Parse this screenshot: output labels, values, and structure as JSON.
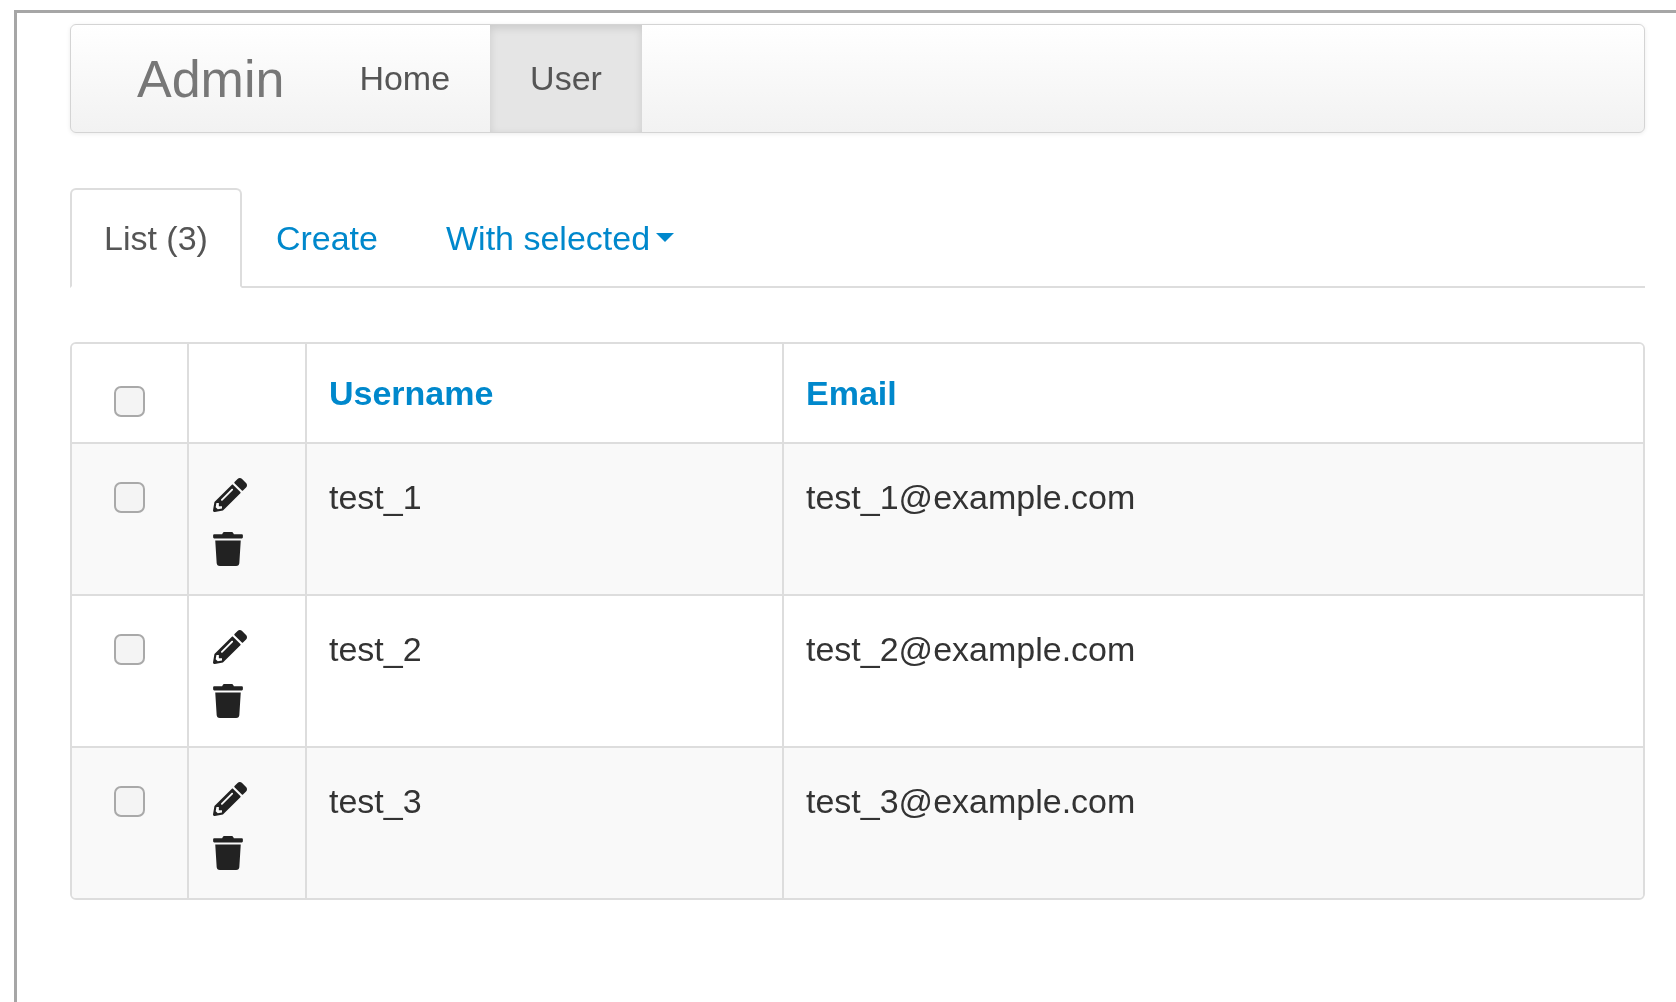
{
  "navbar": {
    "brand": "Admin",
    "items": [
      {
        "label": "Home",
        "selected": false
      },
      {
        "label": "User",
        "selected": true
      }
    ]
  },
  "tabs": [
    {
      "label": "List (3)",
      "selected": true,
      "kind": "tab"
    },
    {
      "label": "Create",
      "selected": false,
      "kind": "tab"
    },
    {
      "label": "With selected",
      "selected": false,
      "kind": "dropdown"
    }
  ],
  "table": {
    "select_all": {
      "checked": false
    },
    "columns": [
      "Username",
      "Email"
    ],
    "rows": [
      {
        "checked": false,
        "username": "test_1",
        "email": "test_1@example.com"
      },
      {
        "checked": false,
        "username": "test_2",
        "email": "test_2@example.com"
      },
      {
        "checked": false,
        "username": "test_3",
        "email": "test_3@example.com"
      }
    ]
  }
}
